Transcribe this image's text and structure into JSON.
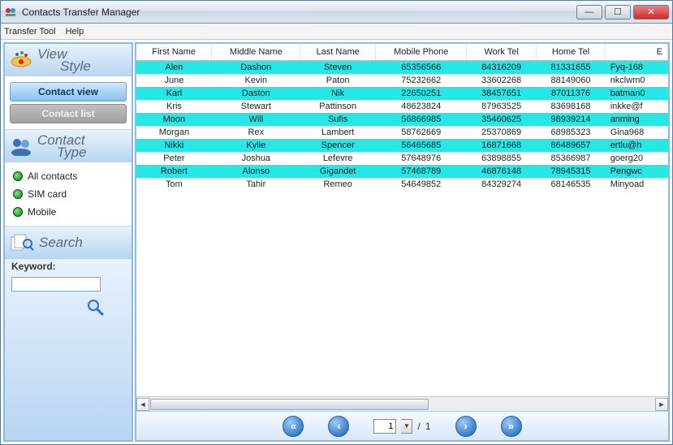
{
  "window": {
    "title": "Contacts Transfer Manager"
  },
  "menu": {
    "transfer_tool": "Transfer Tool",
    "help": "Help"
  },
  "sidebar": {
    "view_style": {
      "label1": "View",
      "label2": "Style"
    },
    "contact_view": "Contact view",
    "contact_list": "Contact list",
    "contact_type": {
      "label1": "Contact",
      "label2": "Type"
    },
    "filters": {
      "all": "All contacts",
      "sim": "SIM card",
      "mobile": "Mobile"
    },
    "search_label": "Search",
    "keyword_label": "Keyword:",
    "keyword_value": ""
  },
  "table": {
    "columns": {
      "first_name": "First Name",
      "middle_name": "Middle Name",
      "last_name": "Last Name",
      "mobile_phone": "Mobile Phone",
      "work_tel": "Work Tel",
      "home_tel": "Home Tel",
      "email": "E"
    },
    "rows": [
      {
        "sel": true,
        "first": "Alen",
        "middle": "Dashon",
        "last": "Steven",
        "mobile": "65356566",
        "work": "84316209",
        "home": "81331655",
        "email": "Fyq-168"
      },
      {
        "sel": false,
        "first": "June",
        "middle": "Kevin",
        "last": "Paton",
        "mobile": "75232662",
        "work": "33602268",
        "home": "88149060",
        "email": "nkclwm0"
      },
      {
        "sel": true,
        "first": "Karl",
        "middle": "Daston",
        "last": "Nik",
        "mobile": "22650251",
        "work": "38457651",
        "home": "87011376",
        "email": "batman0"
      },
      {
        "sel": false,
        "first": "Kris",
        "middle": "Stewart",
        "last": "Pattinson",
        "mobile": "48623824",
        "work": "87963525",
        "home": "83698168",
        "email": "inkke@f"
      },
      {
        "sel": true,
        "first": "Moon",
        "middle": "Will",
        "last": "Sufis",
        "mobile": "56866985",
        "work": "35460625",
        "home": "98939214",
        "email": "anming"
      },
      {
        "sel": false,
        "first": "Morgan",
        "middle": "Rex",
        "last": "Lambert",
        "mobile": "58762669",
        "work": "25370869",
        "home": "68985323",
        "email": "Gina968"
      },
      {
        "sel": true,
        "first": "Nikki",
        "middle": "Kylie",
        "last": "Spencer",
        "mobile": "56465685",
        "work": "16871668",
        "home": "86489657",
        "email": "ertlu@h"
      },
      {
        "sel": false,
        "first": "Peter",
        "middle": "Joshua",
        "last": "Lefevre",
        "mobile": "57648976",
        "work": "63898855",
        "home": "85366987",
        "email": "goerg20"
      },
      {
        "sel": true,
        "first": "Robert",
        "middle": "Alonso",
        "last": "Gigandet",
        "mobile": "57468789",
        "work": "46876148",
        "home": "78945315",
        "email": "Pengwc"
      },
      {
        "sel": false,
        "first": "Tom",
        "middle": "Tahir",
        "last": "Remeo",
        "mobile": "54649852",
        "work": "84329274",
        "home": "68146535",
        "email": "Minyoad"
      }
    ]
  },
  "pager": {
    "current": "1",
    "sep": "/",
    "total": "1"
  }
}
